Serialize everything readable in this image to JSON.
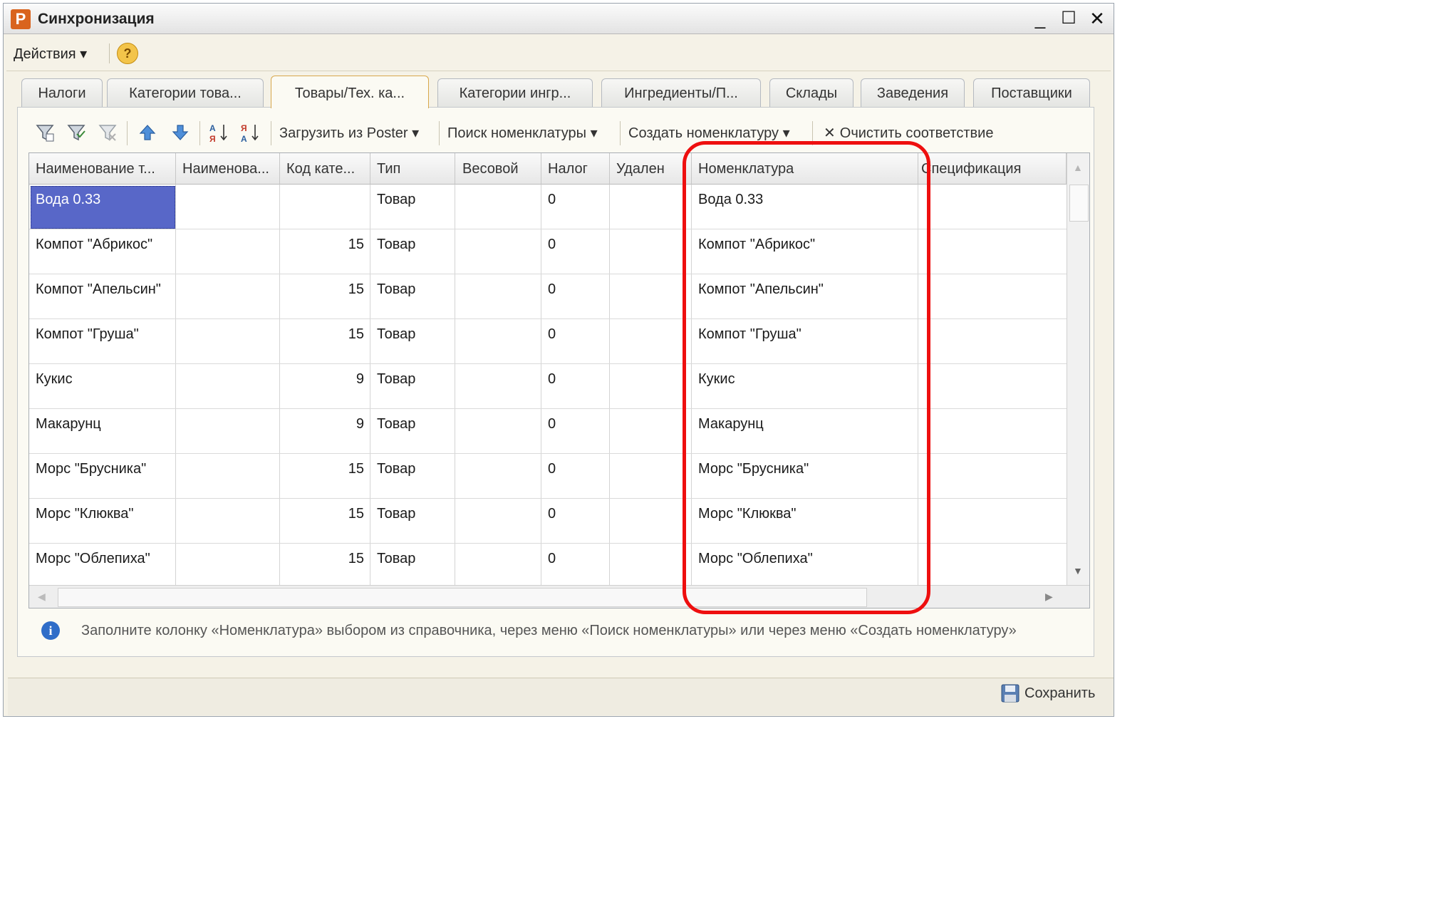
{
  "window": {
    "title": "Синхронизация",
    "logo_letter": "P",
    "minimize_glyph": "_",
    "maximize_glyph": "☐",
    "close_glyph": "✕"
  },
  "menu": {
    "actions_label": "Действия ▾",
    "help_glyph": "?"
  },
  "tabs": [
    {
      "label": "Налоги",
      "active": false
    },
    {
      "label": "Категории това...",
      "active": false
    },
    {
      "label": "Товары/Тех. ка...",
      "active": true
    },
    {
      "label": "Категории ингр...",
      "active": false
    },
    {
      "label": "Ингредиенты/П...",
      "active": false
    },
    {
      "label": "Склады",
      "active": false
    },
    {
      "label": "Заведения",
      "active": false
    },
    {
      "label": "Поставщики",
      "active": false
    }
  ],
  "toolbar": {
    "icons": [
      "filter-set-icon",
      "filter-history-icon",
      "filter-clear-icon",
      "move-up-icon",
      "move-down-icon",
      "sort-ascending-icon",
      "sort-descending-icon"
    ],
    "load_label": "Загрузить из Poster ▾",
    "search_label": "Поиск номенклатуры ▾",
    "create_label": "Создать номенклатуру ▾",
    "clear_label": "Очистить соответствие",
    "clear_glyph": "✕"
  },
  "table": {
    "columns": [
      "Наименование т...",
      "Наименова...",
      "Код кате...",
      "Тип",
      "Весовой",
      "Налог",
      "Удален",
      "Номенклатура",
      "Спецификация"
    ],
    "rows": [
      {
        "name": "Вода 0.33",
        "name2": "",
        "code": "",
        "type": "Товар",
        "weight": "",
        "tax": "0",
        "deleted": "",
        "nomenclature": "Вода 0.33",
        "spec": ""
      },
      {
        "name": "Компот \"Абрикос\"",
        "name2": "",
        "code": "15",
        "type": "Товар",
        "weight": "",
        "tax": "0",
        "deleted": "",
        "nomenclature": "Компот \"Абрикос\"",
        "spec": ""
      },
      {
        "name": "Компот \"Апельсин\"",
        "name2": "",
        "code": "15",
        "type": "Товар",
        "weight": "",
        "tax": "0",
        "deleted": "",
        "nomenclature": "Компот \"Апельсин\"",
        "spec": ""
      },
      {
        "name": "Компот \"Груша\"",
        "name2": "",
        "code": "15",
        "type": "Товар",
        "weight": "",
        "tax": "0",
        "deleted": "",
        "nomenclature": "Компот \"Груша\"",
        "spec": ""
      },
      {
        "name": "Кукис",
        "name2": "",
        "code": "9",
        "type": "Товар",
        "weight": "",
        "tax": "0",
        "deleted": "",
        "nomenclature": "Кукис",
        "spec": ""
      },
      {
        "name": "Макарунц",
        "name2": "",
        "code": "9",
        "type": "Товар",
        "weight": "",
        "tax": "0",
        "deleted": "",
        "nomenclature": "Макарунц",
        "spec": ""
      },
      {
        "name": "Морс \"Брусника\"",
        "name2": "",
        "code": "15",
        "type": "Товар",
        "weight": "",
        "tax": "0",
        "deleted": "",
        "nomenclature": "Морс \"Брусника\"",
        "spec": ""
      },
      {
        "name": "Морс \"Клюква\"",
        "name2": "",
        "code": "15",
        "type": "Товар",
        "weight": "",
        "tax": "0",
        "deleted": "",
        "nomenclature": "Морс \"Клюква\"",
        "spec": ""
      },
      {
        "name": "Морс \"Облепиха\"",
        "name2": "",
        "code": "15",
        "type": "Товар",
        "weight": "",
        "tax": "0",
        "deleted": "",
        "nomenclature": "Морс \"Облепиха\"",
        "spec": ""
      }
    ],
    "selected_row": 0
  },
  "info": {
    "icon_glyph": "i",
    "text": "Заполните колонку «Номенклатура» выбором из справочника, через меню «Поиск номенклатуры» или через меню «Создать номенклатуру»"
  },
  "footer": {
    "save_label": "Сохранить"
  },
  "colors": {
    "selection": "#5867c8",
    "highlight": "#ee0f0f",
    "info": "#2f6dc8"
  }
}
